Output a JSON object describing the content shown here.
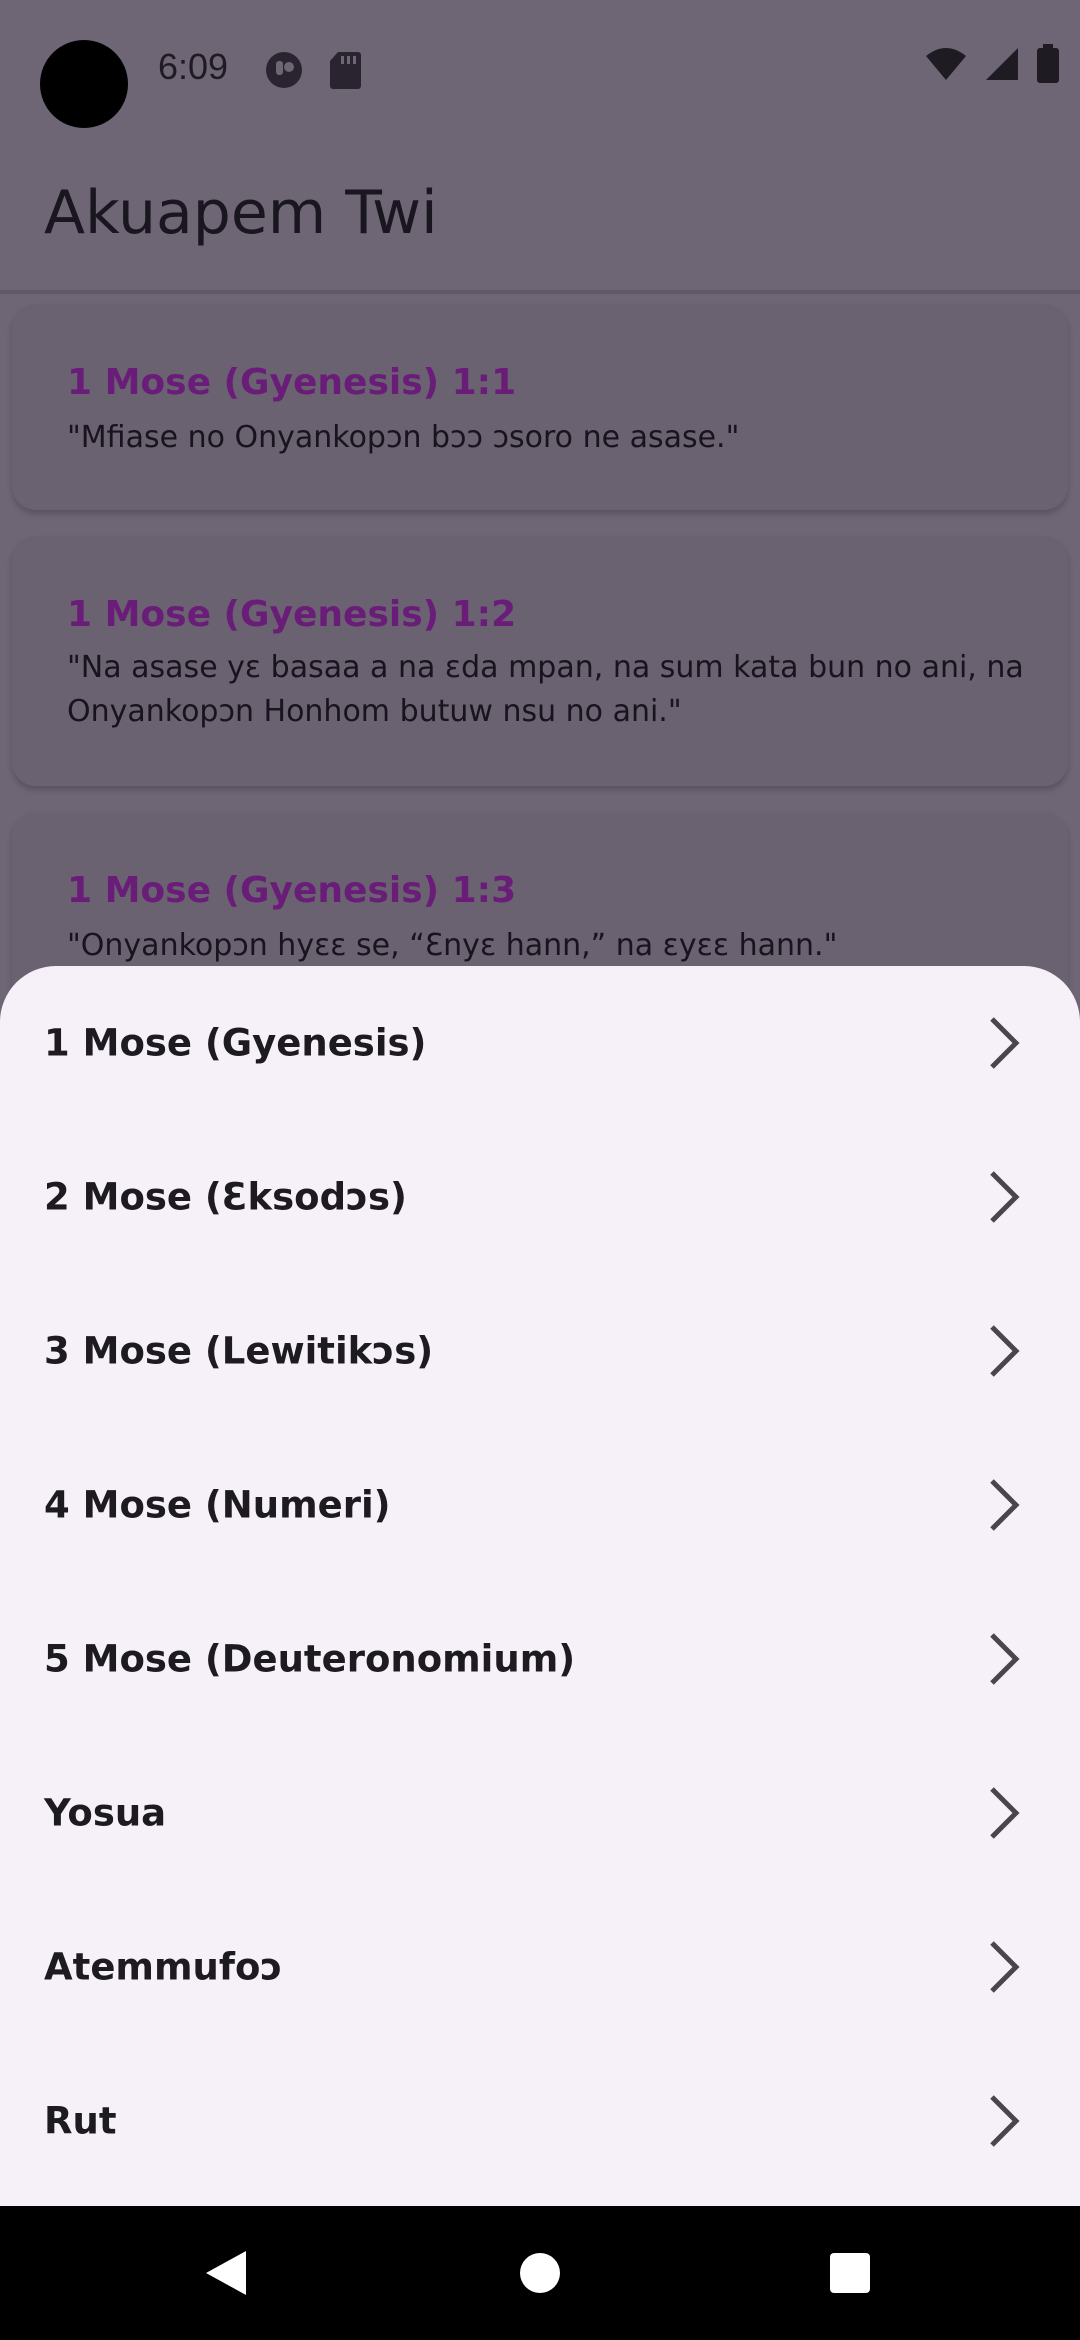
{
  "status_bar": {
    "time": "6:09",
    "icons_left": [
      "app-notification-icon",
      "sd-card-icon"
    ],
    "icons_right": [
      "wifi-icon",
      "signal-icon",
      "battery-icon"
    ]
  },
  "app_bar": {
    "title": "Akuapem Twi"
  },
  "verses": [
    {
      "ref": "1 Mose (Gyenesis) 1:1",
      "text": "\"Mfiase no Onyankopɔn bɔɔ ɔsoro ne asase.\""
    },
    {
      "ref": "1 Mose (Gyenesis) 1:2",
      "text": "\"Na asase yɛ basaa a na ɛda mpan, na sum kata bun no ani, na Onyankopɔn Honhom butuw nsu no ani.\""
    },
    {
      "ref": "1 Mose (Gyenesis) 1:3",
      "text": "\"Onyankopɔn hyɛɛ se, “Ɛnyɛ hann,” na ɛyɛɛ hann.\""
    }
  ],
  "books": [
    {
      "label": "1 Mose (Gyenesis)"
    },
    {
      "label": "2 Mose (Ɛksodɔs)"
    },
    {
      "label": "3 Mose (Lewitikɔs)"
    },
    {
      "label": "4 Mose (Numeri)"
    },
    {
      "label": "5 Mose (Deuteronomium)"
    },
    {
      "label": "Yosua"
    },
    {
      "label": "Atemmufoɔ"
    },
    {
      "label": "Rut"
    }
  ],
  "nav": {
    "back": "back-icon",
    "home": "home-icon",
    "recents": "recents-icon"
  },
  "colors": {
    "scrim": "#6e6575",
    "sheet": "#f6f1f8",
    "verse_ref": "#6a1d78"
  }
}
